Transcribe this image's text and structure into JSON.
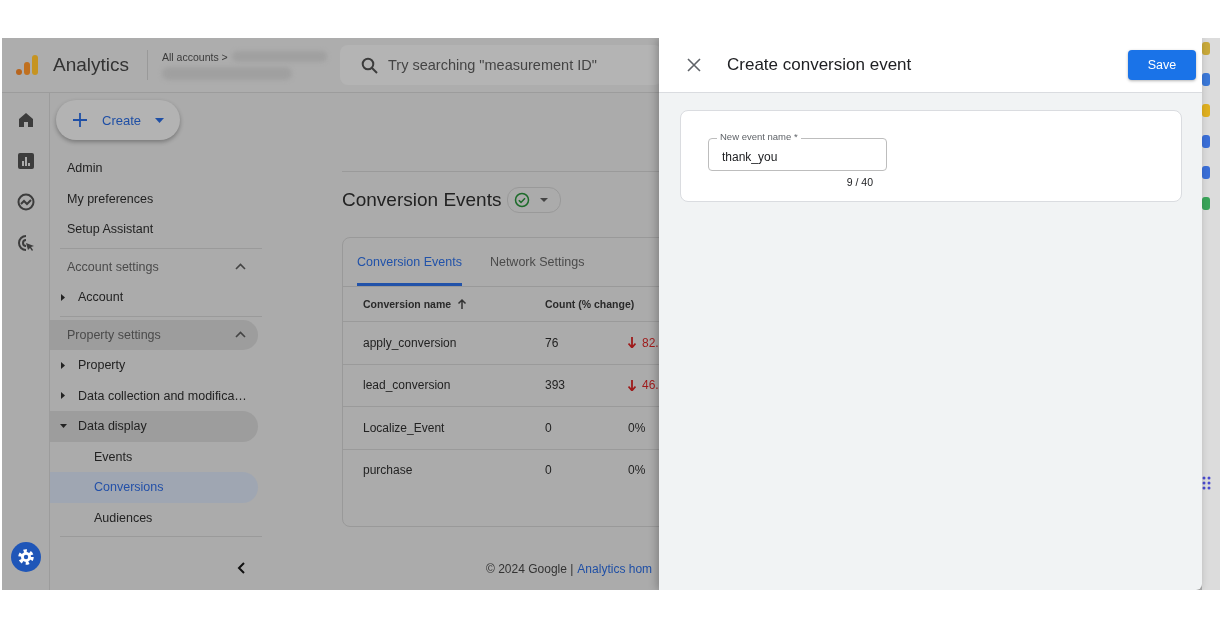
{
  "header": {
    "product": "Analytics",
    "breadcrumb": "All accounts >",
    "search_placeholder": "Try searching \"measurement ID\""
  },
  "sidebar": {
    "create_button": "Create",
    "links": [
      "Admin",
      "My preferences",
      "Setup Assistant"
    ],
    "sections": [
      {
        "title": "Account settings",
        "expanded": true,
        "highlighted": false,
        "items": [
          {
            "label": "Account",
            "expanded": false,
            "highlighted": false
          }
        ]
      },
      {
        "title": "Property settings",
        "expanded": true,
        "highlighted": true,
        "items": [
          {
            "label": "Property",
            "expanded": false,
            "highlighted": false
          },
          {
            "label": "Data collection and modifica…",
            "expanded": false,
            "highlighted": false
          },
          {
            "label": "Data display",
            "expanded": true,
            "highlighted": true,
            "children": [
              {
                "label": "Events",
                "selected": false
              },
              {
                "label": "Conversions",
                "selected": true
              },
              {
                "label": "Audiences",
                "selected": false
              }
            ]
          }
        ]
      }
    ]
  },
  "content": {
    "title": "Conversion Events",
    "verified": true,
    "tabs": [
      {
        "label": "Conversion Events",
        "selected": true
      },
      {
        "label": "Network Settings",
        "selected": false
      }
    ],
    "columns": [
      {
        "label": "Conversion name",
        "sorted": true
      },
      {
        "label": "Count (% change)",
        "sorted": false
      }
    ],
    "rows": [
      {
        "name": "apply_conversion",
        "count": "76",
        "change": "82.",
        "decline": true
      },
      {
        "name": "lead_conversion",
        "count": "393",
        "change": "46.",
        "decline": true
      },
      {
        "name": "Localize_Event",
        "count": "0",
        "change": "0%",
        "decline": false
      },
      {
        "name": "purchase",
        "count": "0",
        "change": "0%",
        "decline": false
      }
    ],
    "footer": {
      "copyright": "© 2024 Google |",
      "link": "Analytics hom"
    }
  },
  "sheet": {
    "title": "Create conversion event",
    "save_button": "Save",
    "field": {
      "label": "New event name *",
      "value": "thank_you",
      "counter": "9 / 40"
    }
  }
}
